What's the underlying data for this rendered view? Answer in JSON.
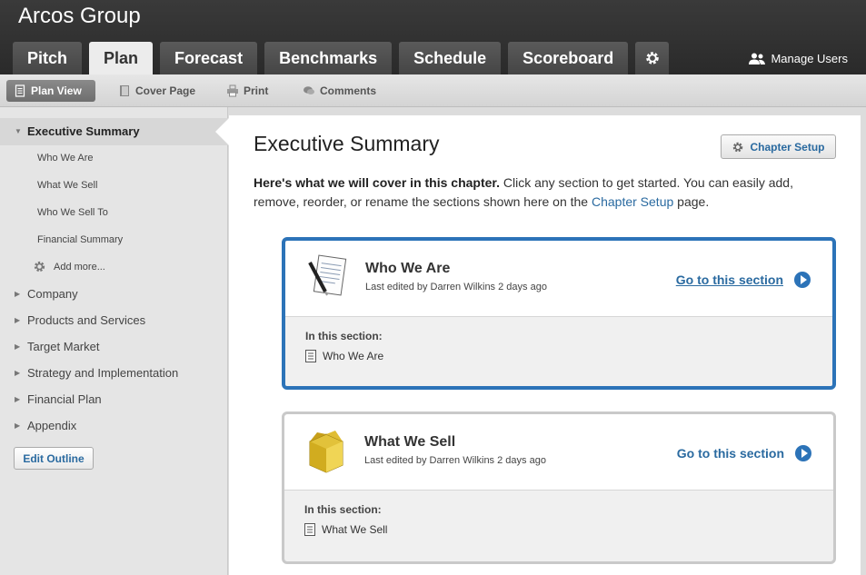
{
  "app": {
    "title": "Arcos Group"
  },
  "tabs": [
    {
      "label": "Pitch"
    },
    {
      "label": "Plan"
    },
    {
      "label": "Forecast"
    },
    {
      "label": "Benchmarks"
    },
    {
      "label": "Schedule"
    },
    {
      "label": "Scoreboard"
    }
  ],
  "header": {
    "manage_users": "Manage Users"
  },
  "subnav": {
    "plan_view": "Plan View",
    "cover_page": "Cover Page",
    "print": "Print",
    "comments": "Comments"
  },
  "sidebar": {
    "active_chapter": "Executive Summary",
    "sections": [
      "Who We Are",
      "What We Sell",
      "Who We Sell To",
      "Financial Summary"
    ],
    "add_more": "Add more...",
    "chapters": [
      "Company",
      "Products and Services",
      "Target Market",
      "Strategy and Implementation",
      "Financial Plan",
      "Appendix"
    ],
    "edit_outline": "Edit Outline"
  },
  "main": {
    "title": "Executive Summary",
    "chapter_setup": "Chapter Setup",
    "intro_bold": "Here's what we will cover in this chapter.",
    "intro_text": " Click any section to get started. You can easily add, remove, reorder, or rename the sections shown here on the ",
    "intro_link": "Chapter Setup",
    "intro_end": " page.",
    "cards": [
      {
        "title": "Who We Are",
        "subtitle": "Last edited by Darren Wilkins 2 days ago",
        "go_label": "Go to this section",
        "in_section": "In this section:",
        "item": "Who We Are"
      },
      {
        "title": "What We Sell",
        "subtitle": "Last edited by Darren Wilkins 2 days ago",
        "go_label": "Go to this section",
        "in_section": "In this section:",
        "item": "What We Sell"
      }
    ]
  },
  "colors": {
    "accent": "#2c73b8",
    "link": "#2a6aa0",
    "topbar": "#2f2f2f"
  }
}
